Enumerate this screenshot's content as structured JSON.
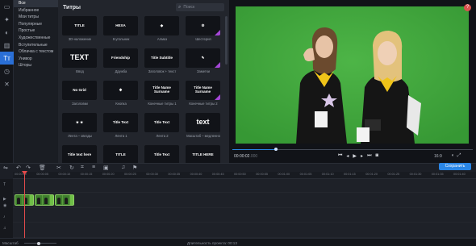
{
  "toolbar": {
    "items": [
      {
        "icon": "import-icon",
        "glyph": "▭"
      },
      {
        "icon": "magic-wand-icon",
        "glyph": "✦"
      },
      {
        "icon": "filters-icon",
        "glyph": "◐"
      },
      {
        "icon": "transitions-icon",
        "glyph": "▥"
      },
      {
        "icon": "titles-icon",
        "glyph": "Tт"
      },
      {
        "icon": "stickers-icon",
        "glyph": "◷"
      },
      {
        "icon": "more-tools-icon",
        "glyph": "✕"
      }
    ]
  },
  "categories": [
    "Все",
    "Избранное",
    "Мои титры",
    "Популярные",
    "Простые",
    "Художественные",
    "Вступительные",
    "Облачка с текстом",
    "Унивор",
    "Шторы"
  ],
  "titles_panel": {
    "heading": "Титры",
    "search_placeholder": "Поиск",
    "tiles": [
      {
        "label": "3D-наложение",
        "thumb": "TITLE"
      },
      {
        "label": "8-угольник",
        "thumb": "HEXA"
      },
      {
        "label": "Алмаз",
        "thumb": "◆"
      },
      {
        "label": "Шестерня",
        "thumb": "⚙"
      },
      {
        "label": "Ввод",
        "thumb": "TEXT"
      },
      {
        "label": "Дружба",
        "thumb": "Friendship"
      },
      {
        "label": "Заголовок + текст",
        "thumb": "Title Subtitle"
      },
      {
        "label": "Заметки",
        "thumb": "✎"
      },
      {
        "label": "Заголовки",
        "thumb": "No Grid"
      },
      {
        "label": "Кнопка",
        "thumb": "✱"
      },
      {
        "label": "Конечные титры 1",
        "thumb": "Title Name Surname"
      },
      {
        "label": "Конечные титры 2",
        "thumb": "Title Name Surname"
      },
      {
        "label": "Лента – звезды",
        "thumb": "★ ★"
      },
      {
        "label": "Лента 1",
        "thumb": "Title Text"
      },
      {
        "label": "Лента 2",
        "thumb": "Title Text"
      },
      {
        "label": "Масштаб – медленно",
        "thumb": "text"
      },
      {
        "label": "",
        "thumb": "Title text here"
      },
      {
        "label": "",
        "thumb": "TITLE"
      },
      {
        "label": "",
        "thumb": "Title Text"
      },
      {
        "label": "",
        "thumb": "TITLE HERE"
      }
    ]
  },
  "preview": {
    "timecode_main": "00:00:02",
    "timecode_frac": ".000",
    "aspect_ratio": "16:9",
    "playback_position": 0.18
  },
  "edit_toolbar": {
    "save_label": "Сохранить"
  },
  "ruler": {
    "ticks": [
      "00:00:00",
      "00:00:05",
      "00:00:10",
      "00:00:15",
      "00:00:20",
      "00:00:25",
      "00:00:30",
      "00:00:35",
      "00:00:40",
      "00:00:45",
      "00:00:50",
      "00:00:55",
      "00:01:00",
      "00:01:05",
      "00:01:10",
      "00:01:15",
      "00:01:20",
      "00:01:25",
      "00:01:30",
      "00:01:35",
      "00:01:40"
    ]
  },
  "status": {
    "zoom_label": "Масштаб",
    "zoom_level": 0.45,
    "duration": "Длительность проекта: 00:13"
  },
  "colors": {
    "accent": "#2a86e6",
    "chroma_green": "#3ea63b",
    "clip_green": "#6fbf47",
    "playhead": "#e24b4b"
  }
}
